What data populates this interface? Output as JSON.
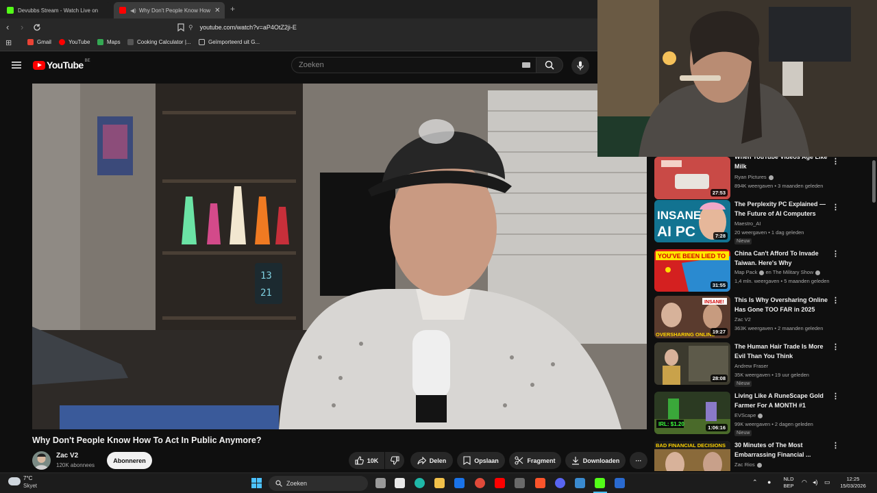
{
  "browser": {
    "tabs": [
      {
        "title": "Devubbs Stream - Watch Live on",
        "active": false
      },
      {
        "title": "Why Don't People Know How",
        "active": true
      }
    ],
    "new_tab": "+",
    "url": "youtube.com/watch?v=aP4OtZ2ji-E",
    "bookmarks": [
      {
        "label": "Gmail",
        "icon": "gmail-icon"
      },
      {
        "label": "YouTube",
        "icon": "youtube-icon"
      },
      {
        "label": "Maps",
        "icon": "maps-icon"
      },
      {
        "label": "Cooking Calculator |...",
        "icon": "cooking-icon"
      },
      {
        "label": "Geïmporteerd uit G...",
        "icon": "folder-icon"
      }
    ]
  },
  "youtube": {
    "logo_text": "YouTube",
    "country": "BE",
    "search_placeholder": "Zoeken"
  },
  "video": {
    "title": "Why Don't People Know How To Act In Public Anymore?",
    "channel": "Zac V2",
    "subscribers": "120K abonnees",
    "subscribe_label": "Abonneren",
    "likes": "10K",
    "share_label": "Delen",
    "save_label": "Opslaan",
    "clip_label": "Fragment",
    "download_label": "Downloaden",
    "more_label": "···"
  },
  "recommendations": [
    {
      "title": "When YouTube Videos Age Like Milk",
      "channel": "Ryan Pictures",
      "verified": true,
      "meta": "894K weergaven • 3 maanden geleden",
      "duration": "27:53",
      "badge": ""
    },
    {
      "title": "The Perplexity PC Explained — The Future of AI Computers",
      "channel": "Maestro_AI",
      "verified": false,
      "meta": "20 weergaven • 1 dag geleden",
      "duration": "7:28",
      "badge": "Nieuw",
      "thumb_text": "INSANE AI PC"
    },
    {
      "title": "China Can't Afford To Invade Taiwan. Here's Why",
      "channel": "Map Pack",
      "verified": true,
      "channel_suffix": "en The Military Show",
      "meta": "1,4 mln. weergaven • 5 maanden geleden",
      "duration": "31:55",
      "badge": "",
      "thumb_text": "YOU'VE BEEN LIED TO"
    },
    {
      "title": "This Is Why Oversharing Online Has Gone TOO FAR in 2025",
      "channel": "Zac V2",
      "verified": false,
      "meta": "363K weergaven • 2 maanden geleden",
      "duration": "19:27",
      "badge": "",
      "thumb_text": "OVERSHARING ONLINE"
    },
    {
      "title": "The Human Hair Trade Is More Evil Than You Think",
      "channel": "Andrew Fraser",
      "verified": false,
      "meta": "35K weergaven • 19 uur geleden",
      "duration": "28:08",
      "badge": "Nieuw"
    },
    {
      "title": "Living Like A RuneScape Gold Farmer For A MONTH #1",
      "channel": "EVScape",
      "verified": true,
      "meta": "99K weergaven • 2 dagen geleden",
      "duration": "1:06:16",
      "badge": "Nieuw",
      "thumb_text": "IRL: $1.20"
    },
    {
      "title": "30 Minutes of The Most Embarrassing Financial ...",
      "channel": "Zac Rios",
      "verified": true,
      "meta": "",
      "duration": "",
      "badge": "",
      "thumb_text": "BAD FINANCIAL DECISIONS"
    }
  ],
  "taskbar": {
    "weather_temp": "7°C",
    "weather_desc": "Skyet",
    "search_label": "Zoeken",
    "lang_top": "NLD",
    "lang_bottom": "BEP",
    "time": "12:25",
    "date": "15/03/2026"
  }
}
